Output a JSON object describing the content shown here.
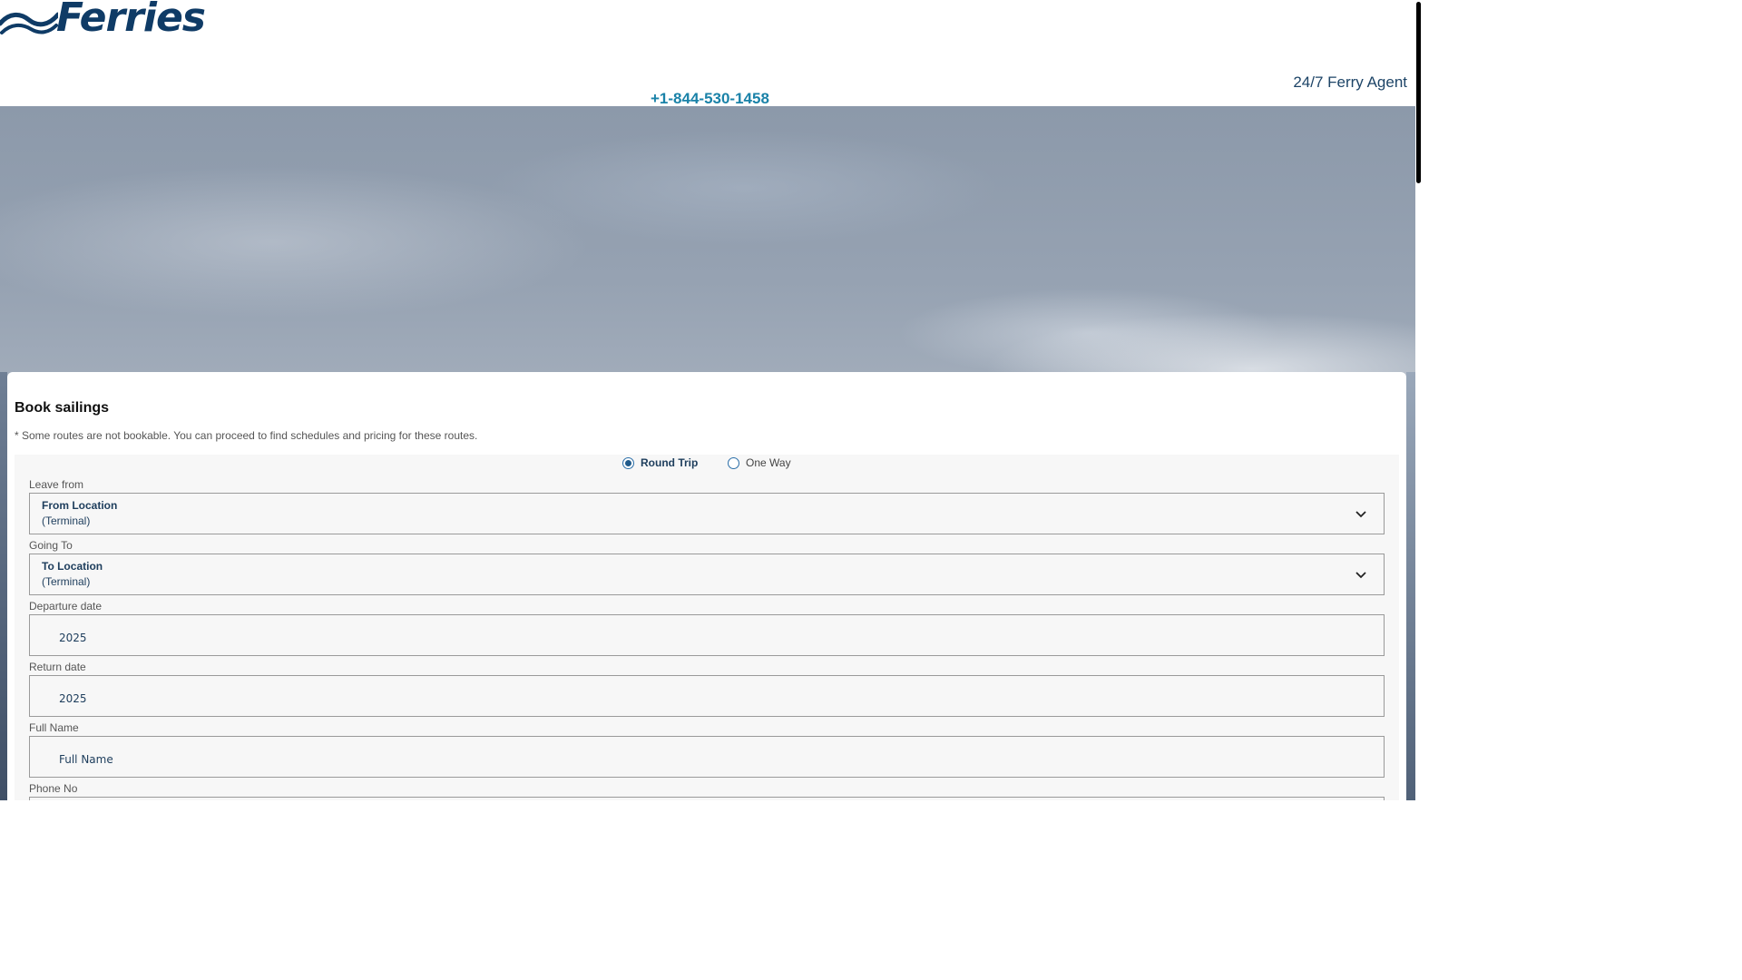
{
  "header": {
    "logo_text": "Ferries",
    "agent_text": "24/7 Ferry Agent",
    "phone": "+1-844-530-1458"
  },
  "booking": {
    "title": "Book sailings",
    "note": "* Some routes are not bookable. You can proceed to find schedules and pricing for these routes.",
    "trip_types": {
      "round_trip": "Round Trip",
      "one_way": "One Way",
      "selected": "Round Trip"
    },
    "leave_from": {
      "label": "Leave from",
      "main": "From Location",
      "sub": "(Terminal)"
    },
    "going_to": {
      "label": "Going To",
      "main": "To Location",
      "sub": "(Terminal)"
    },
    "departure_date": {
      "label": "Departure date",
      "value": "2025"
    },
    "return_date": {
      "label": "Return date",
      "value": "2025"
    },
    "full_name": {
      "label": "Full Name",
      "placeholder": "Full Name"
    },
    "phone_no": {
      "label": "Phone No"
    }
  },
  "colors": {
    "brand": "#0f3b66",
    "phone_link": "#1a82a8",
    "radio": "#1f5a8a"
  }
}
